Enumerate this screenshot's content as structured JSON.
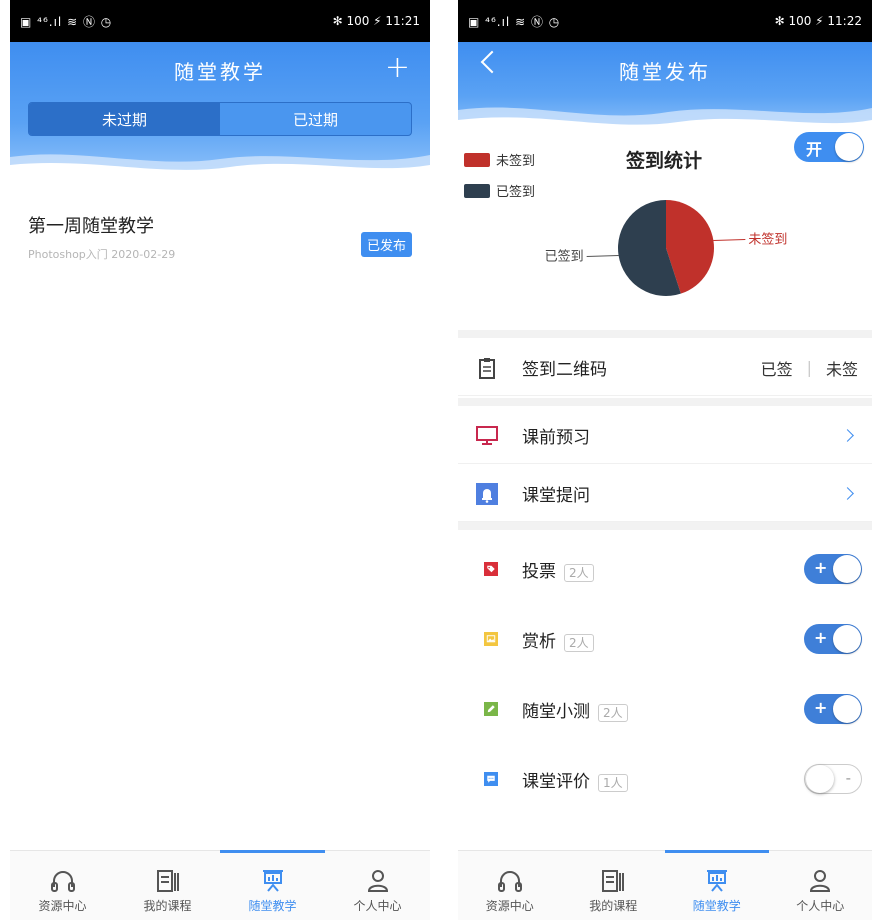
{
  "left": {
    "status": {
      "left": "▣ ⁴⁶.ıl ≋ Ⓝ ◷",
      "right": "✻ 100 ⚡ 11:21"
    },
    "header": {
      "title": "随堂教学",
      "plus": "+"
    },
    "segments": [
      "未过期",
      "已过期"
    ],
    "course": {
      "name": "第一周随堂教学",
      "meta": "Photoshop入门 2020-02-29",
      "badge": "已发布"
    }
  },
  "right": {
    "status": {
      "left": "▣ ⁴⁶.ıl ≋ Ⓝ ◷",
      "right": "✻ 100 ⚡ 11:22"
    },
    "header": {
      "title": "随堂发布"
    },
    "toggle_label": "开",
    "qr": {
      "label": "签到二维码",
      "signed": "已签",
      "divider": "|",
      "unsigned": "未签"
    },
    "menu": [
      {
        "label": "课前预习",
        "icon": "monitor-icon"
      },
      {
        "label": "课堂提问",
        "icon": "bell-icon"
      }
    ],
    "activities": [
      {
        "label": "投票",
        "count": "2人",
        "on": true,
        "icon": "tag-icon"
      },
      {
        "label": "赏析",
        "count": "2人",
        "on": true,
        "icon": "image-icon"
      },
      {
        "label": "随堂小测",
        "count": "2人",
        "on": true,
        "icon": "pencil-icon"
      },
      {
        "label": "课堂评价",
        "count": "1人",
        "on": false,
        "icon": "chat-icon"
      }
    ]
  },
  "tabs": [
    "资源中心",
    "我的课程",
    "随堂教学",
    "个人中心"
  ],
  "chart_data": {
    "type": "pie",
    "title": "签到统计",
    "legend": [
      "未签到",
      "已签到"
    ],
    "categories": [
      "未签到",
      "已签到"
    ],
    "values": [
      45,
      55
    ],
    "colors": [
      "#c0312b",
      "#2e3f4f"
    ],
    "legend_position": "top-left"
  }
}
